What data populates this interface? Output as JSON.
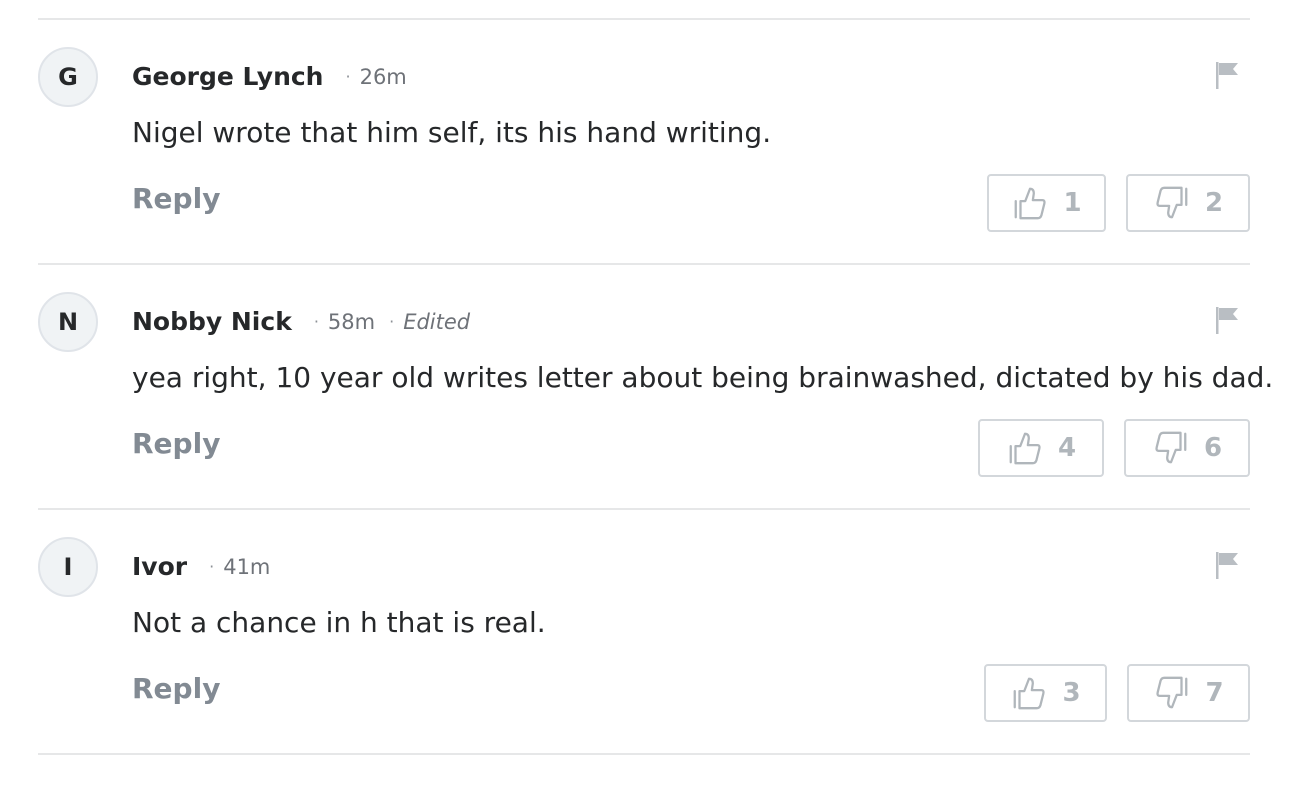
{
  "icons": {
    "thumbs_up": "thumbs-up-icon",
    "thumbs_down": "thumbs-down-icon",
    "flag": "flag-icon"
  },
  "colors": {
    "text": "#26282a",
    "muted": "#6e7278",
    "reply": "#828a93",
    "vote": "#b0b6bb",
    "border": "#d3d7db",
    "avatar_bg": "#f0f3f5"
  },
  "comments": [
    {
      "initial": "G",
      "author": "George Lynch",
      "time": "26m",
      "edited": "",
      "text": "Nigel wrote that him self, its his hand writing.",
      "reply_label": "Reply",
      "upvotes": "1",
      "downvotes": "2"
    },
    {
      "initial": "N",
      "author": "Nobby Nick",
      "time": "58m",
      "edited": "Edited",
      "text": "yea right, 10 year old writes letter about being brainwashed, dictated by his dad.",
      "reply_label": "Reply",
      "upvotes": "4",
      "downvotes": "6"
    },
    {
      "initial": "I",
      "author": "Ivor",
      "time": "41m",
      "edited": "",
      "text": "Not a chance in h that is real.",
      "reply_label": "Reply",
      "upvotes": "3",
      "downvotes": "7"
    }
  ]
}
